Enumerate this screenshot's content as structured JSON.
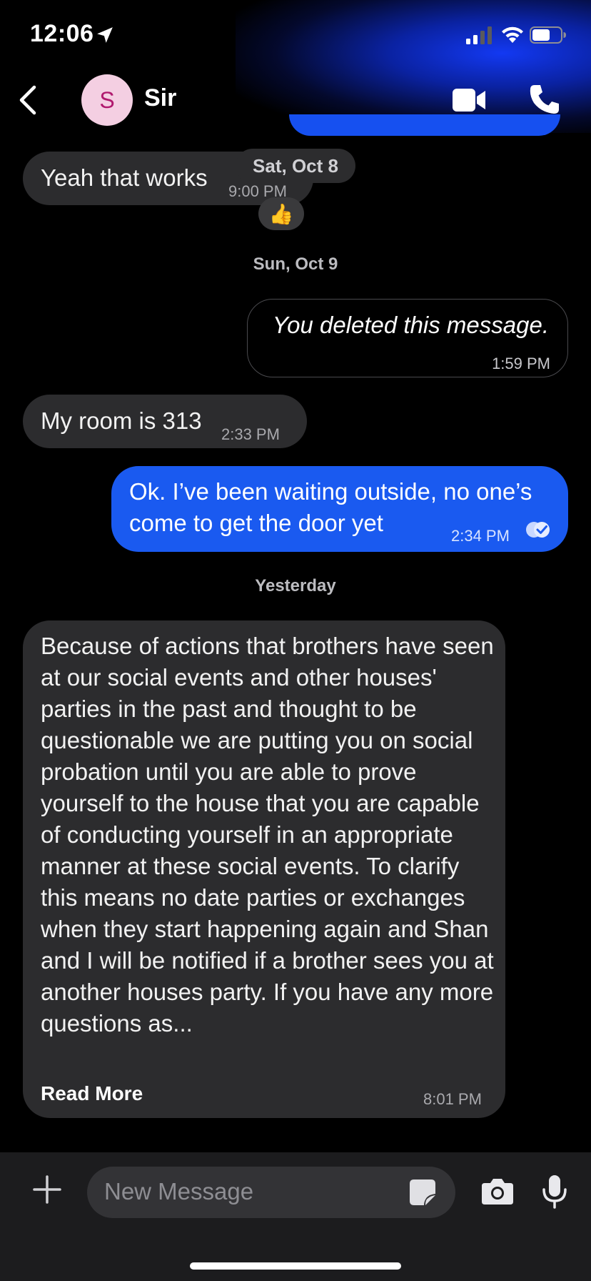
{
  "status_bar": {
    "time": "12:06"
  },
  "header": {
    "avatar_letter": "S",
    "contact_name": "Sir"
  },
  "messages": [
    {
      "side": "incoming",
      "text": "Yeah that works",
      "time": "9:00 PM",
      "reaction": "👍"
    },
    {
      "side": "outgoing",
      "text": "You deleted this message.",
      "time": "1:59 PM",
      "deleted": true
    },
    {
      "side": "incoming",
      "text": "My room is 313",
      "time": "2:33 PM"
    },
    {
      "side": "outgoing",
      "text": "Ok. I’ve been waiting outside, no one’s come to get the door yet",
      "time": "2:34 PM",
      "read": true
    },
    {
      "side": "incoming",
      "text": "Because of actions that brothers have seen at our social events and other houses' parties in the past and thought to be questionable we are putting you on social probation until you are able to prove yourself to the house that you are capable of conducting yourself in an appropriate manner at these social events.  To clarify this means no date parties or exchanges when they start happening again and Shan and I will be notified if a brother sees you at another houses party.  If you have any more questions as...",
      "time": "8:01 PM",
      "read_more_label": "Read More"
    }
  ],
  "date_labels": {
    "floating": "Sat, Oct 8",
    "sun": "Sun, Oct 9",
    "yesterday": "Yesterday"
  },
  "composer": {
    "placeholder": "New Message"
  },
  "colors": {
    "outgoing_bubble": "#1a5af0",
    "incoming_bubble": "#2c2c2e",
    "background": "#000000"
  }
}
